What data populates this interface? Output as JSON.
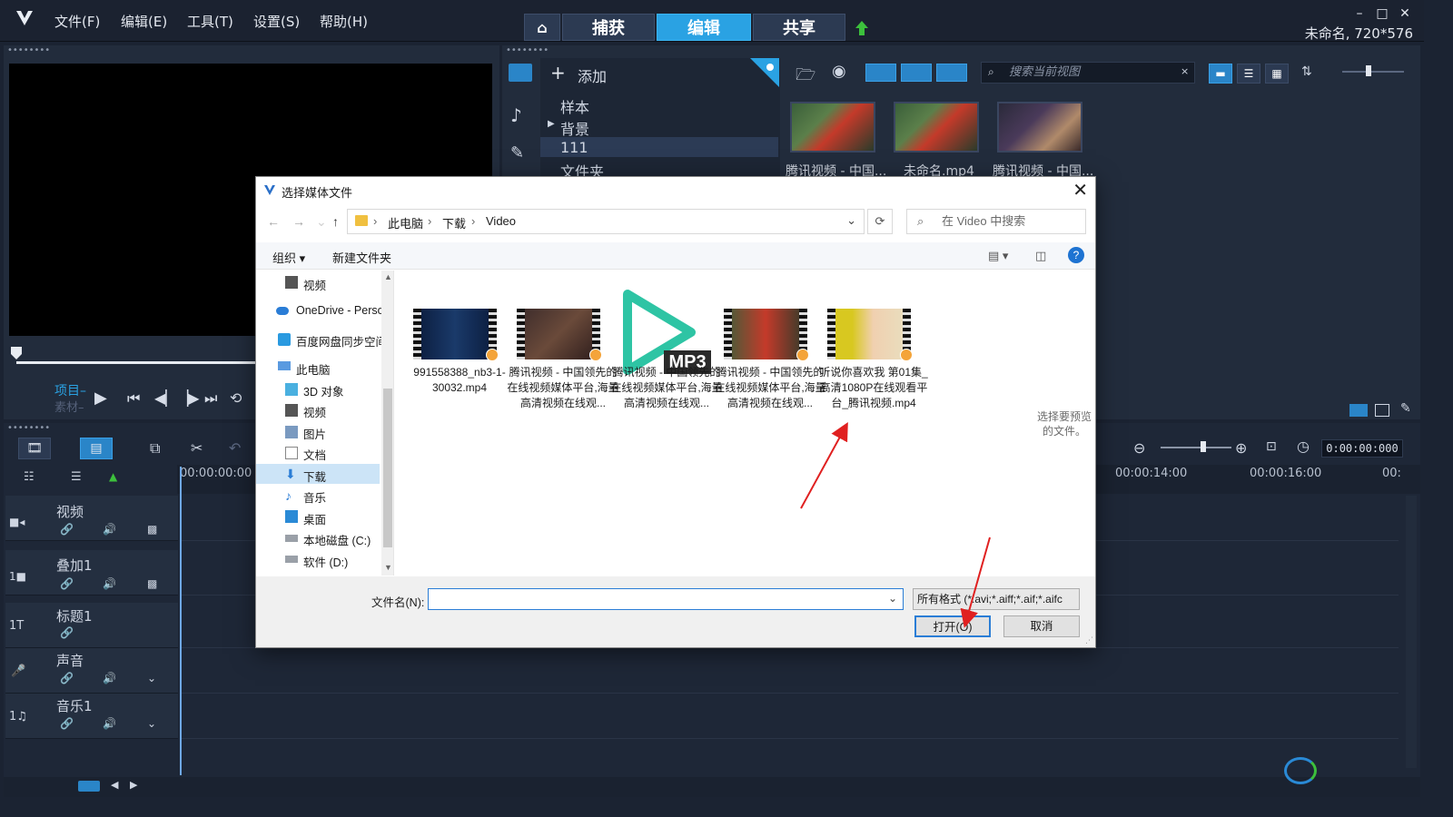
{
  "menu": [
    "文件(F)",
    "编辑(E)",
    "工具(T)",
    "设置(S)",
    "帮助(H)"
  ],
  "mode_tabs": {
    "capture": "捕获",
    "edit": "编辑",
    "share": "共享"
  },
  "project_info": "未命名, 720*576",
  "preview": {
    "project_label": "项目–",
    "clip_label": "素材–"
  },
  "library": {
    "add_label": "添加",
    "tree": [
      "样本",
      "背景",
      "111",
      "文件夹"
    ],
    "search_placeholder": "搜索当前视图",
    "thumbs": [
      "腾讯视频 - 中国...",
      "未命名.mp4",
      "腾讯视频 - 中国..."
    ]
  },
  "timeline": {
    "timecode": "0:00:00:000",
    "ruler": [
      "00:00:00:00",
      "00:00:14:00",
      "00:00:16:00",
      "00:"
    ],
    "tracks": [
      "视频",
      "叠加1",
      "标题1",
      "声音",
      "音乐1"
    ]
  },
  "dialog": {
    "title": "选择媒体文件",
    "breadcrumb": [
      "此电脑",
      "下载",
      "Video"
    ],
    "search_placeholder": "在 Video 中搜索",
    "organize": "组织 ▾",
    "new_folder": "新建文件夹",
    "nav": [
      "视频",
      "OneDrive - Perso",
      "百度网盘同步空间",
      "此电脑",
      "3D 对象",
      "视频",
      "图片",
      "文档",
      "下载",
      "音乐",
      "桌面",
      "本地磁盘 (C:)",
      "软件 (D:)"
    ],
    "files": [
      "991558388_nb3-1-30032.mp4",
      "腾讯视频 - 中国领先的在线视频媒体平台,海量高清视频在线观...",
      "腾讯视频 - 中国领先的在线视频媒体平台,海量高清视频在线观...",
      "腾讯视频 - 中国领先的在线视频媒体平台,海量高清视频在线观...",
      "听说你喜欢我 第01集_高清1080P在线观看平台_腾讯视频.mp4"
    ],
    "mp3_badge": "MP3",
    "preview_hint": "选择要预览的文件。",
    "filename_label": "文件名(N):",
    "filename_value": "",
    "filetype": "所有格式 (*.avi;*.aiff;*.aif;*.aifc",
    "open": "打开(O)",
    "cancel": "取消"
  },
  "colors": {
    "accent": "#2aa2e3",
    "arrow": "#e02020"
  }
}
